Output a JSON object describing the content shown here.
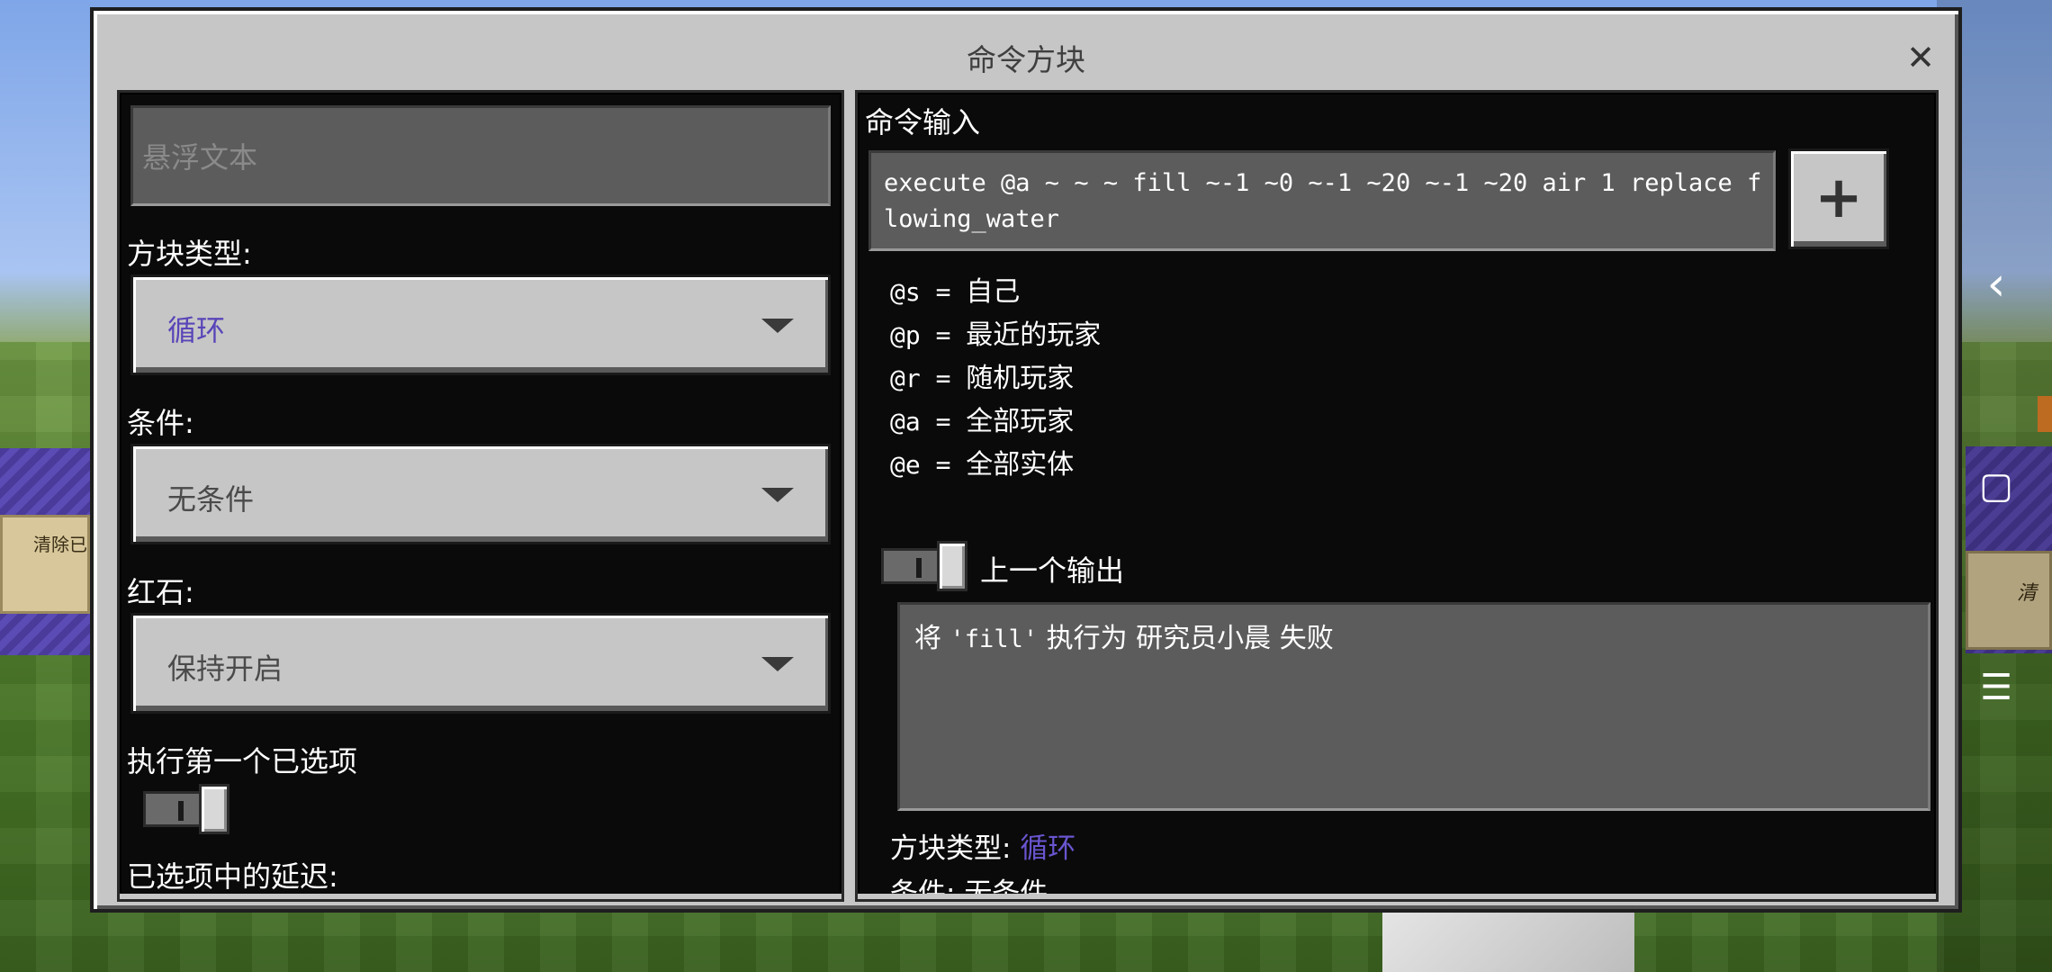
{
  "background": {
    "left_sign_text": "清除已",
    "right_sign_text": "清"
  },
  "nav": {
    "back_icon": "‹",
    "home_icon": "▢",
    "menu_icon": "☰"
  },
  "dialog": {
    "title": "命令方块",
    "close_icon": "✕"
  },
  "left_panel": {
    "hover_text_placeholder": "悬浮文本",
    "block_type_label": "方块类型:",
    "block_type_value": "循环",
    "condition_label": "条件:",
    "condition_value": "无条件",
    "redstone_label": "红石:",
    "redstone_value": "保持开启",
    "execute_first_label": "执行第一个已选项",
    "delay_label": "已选项中的延迟:"
  },
  "right_panel": {
    "command_input_label": "命令输入",
    "command_value": "execute @a ~ ~ ~ fill ~-1 ~0 ~-1 ~20 ~-1 ~20 air 1 replace flowing_water",
    "plus_label": "+",
    "selectors": [
      {
        "code": "@s",
        "eq": " = ",
        "desc": "自己"
      },
      {
        "code": "@p",
        "eq": " = ",
        "desc": "最近的玩家"
      },
      {
        "code": "@r",
        "eq": " = ",
        "desc": "随机玩家"
      },
      {
        "code": "@a",
        "eq": " = ",
        "desc": "全部玩家"
      },
      {
        "code": "@e",
        "eq": " = ",
        "desc": "全部实体"
      }
    ],
    "previous_output_label": "上一个输出",
    "output_prefix": "将 ",
    "output_code": "'fill'",
    "output_suffix": " 执行为 研究员小晨 失败",
    "info_block_type_label": "方块类型: ",
    "info_block_type_value": "循环",
    "info_condition_label": "条件: ",
    "info_condition_value": "无条件"
  },
  "colors": {
    "accent": "#5a45b8",
    "panel_bg": "#0a0a0a",
    "dialog_bg": "#c6c6c6"
  }
}
